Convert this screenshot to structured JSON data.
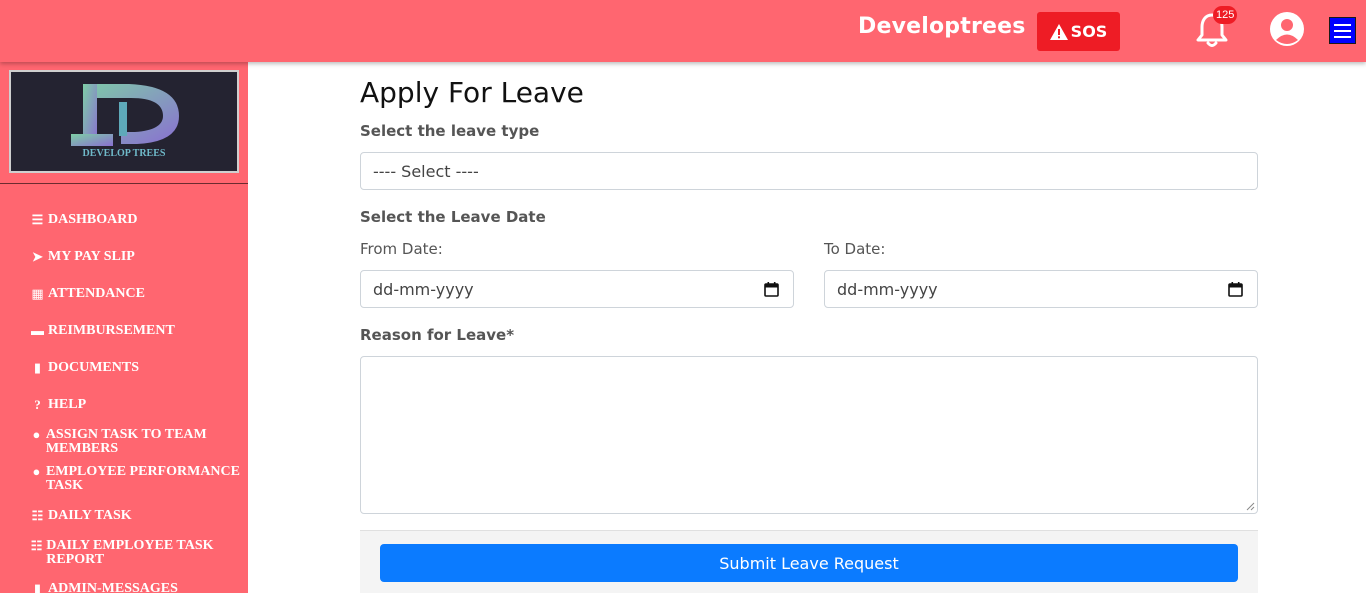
{
  "header": {
    "brand": "Developtrees",
    "sos_label": "SOS",
    "notification_count": "125"
  },
  "sidebar": {
    "logo_text": "DEVELOP TREES",
    "items": [
      {
        "label": "DASHBOARD",
        "icon": "list-icon"
      },
      {
        "label": "MY PAY SLIP",
        "icon": "paper-plane-icon"
      },
      {
        "label": "ATTENDANCE",
        "icon": "calendar-icon"
      },
      {
        "label": "REIMBURSEMENT",
        "icon": "credit-card-icon"
      },
      {
        "label": "DOCUMENTS",
        "icon": "file-icon"
      },
      {
        "label": "HELP",
        "icon": "question-circle-icon"
      },
      {
        "label": "ASSIGN TASK TO TEAM MEMBERS",
        "icon": "users-icon"
      },
      {
        "label": "EMPLOYEE PERFORMANCE TASK",
        "icon": "user-edit-icon"
      },
      {
        "label": "DAILY TASK",
        "icon": "task-list-icon"
      },
      {
        "label": "DAILY EMPLOYEE TASK REPORT",
        "icon": "task-list-icon"
      },
      {
        "label": "ADMIN-MESSAGES",
        "icon": "file-icon"
      }
    ]
  },
  "form": {
    "title": "Apply For Leave",
    "leave_type_label": "Select the leave type",
    "leave_type_value": "---- Select ----",
    "leave_date_label": "Select the Leave Date",
    "from_label": "From Date:",
    "to_label": "To Date:",
    "from_placeholder": "dd-mm-yyyy",
    "to_placeholder": "dd-mm-yyyy",
    "reason_label": "Reason for Leave*",
    "submit_label": "Submit Leave Request"
  },
  "colors": {
    "header_bg": "#ff6670",
    "sos_bg": "#ee1c25",
    "menu_toggle": "#0000ff",
    "submit_bg": "#0b7bff"
  }
}
